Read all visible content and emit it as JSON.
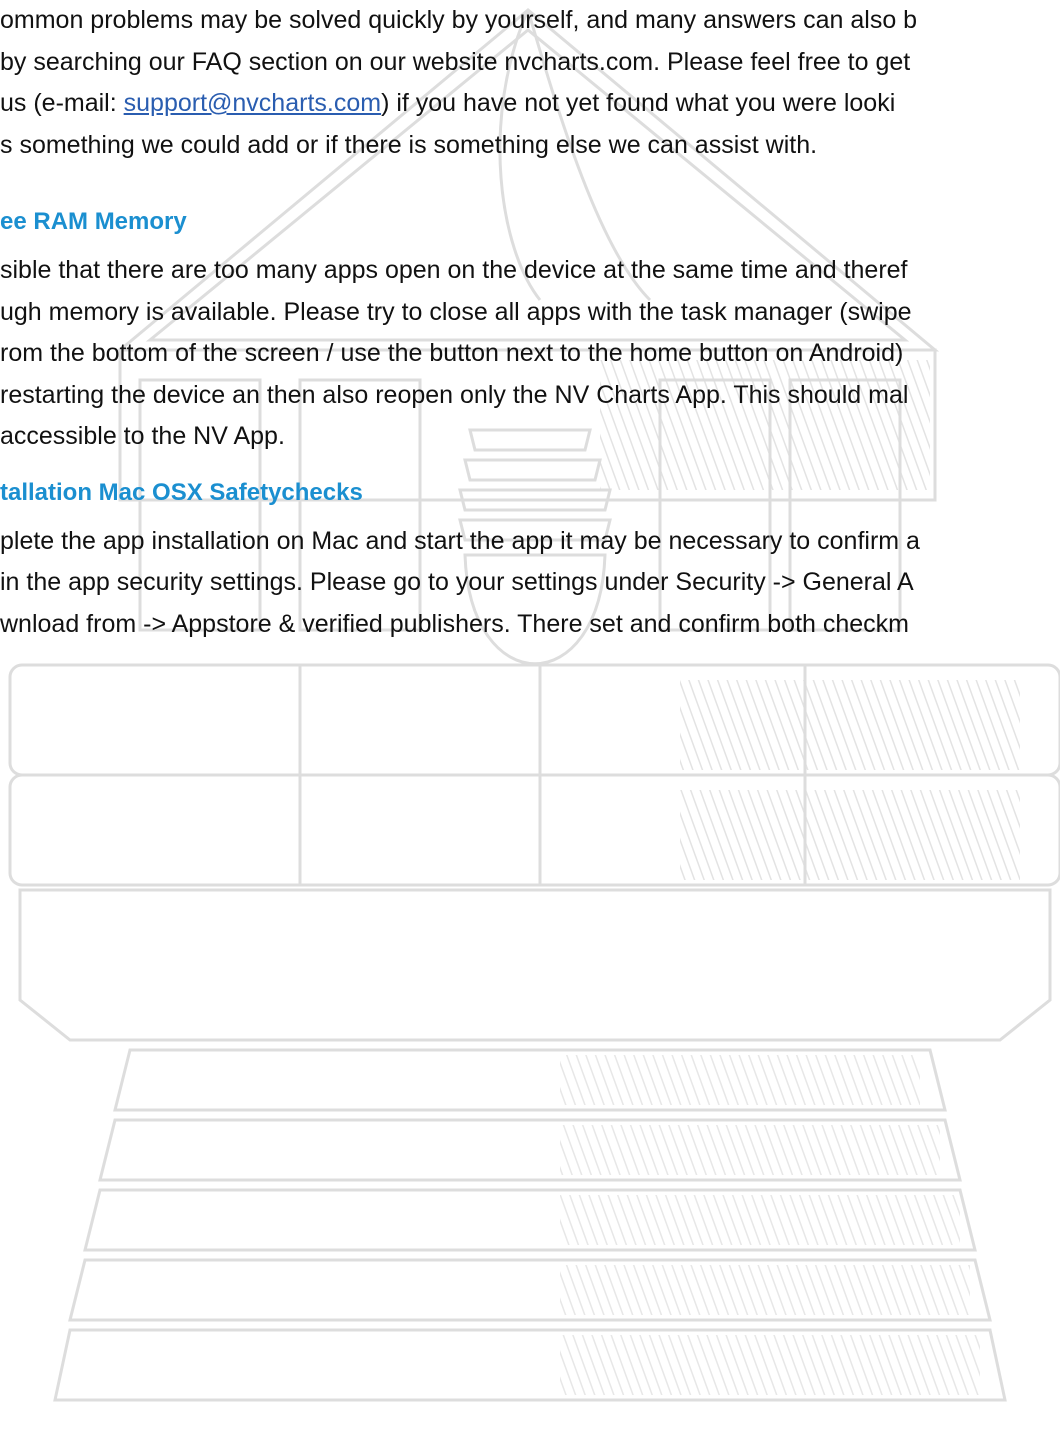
{
  "watermark": {
    "icon": "lighthouse-watermark-icon",
    "color": "#d9d9d9"
  },
  "section_faq": {
    "lines": [
      {
        "pre": "ommon problems may be solved quickly by yourself, and many answers can also b"
      },
      {
        "pre": "by searching our FAQ section on our website nvcharts.com. Please feel free to get"
      },
      {
        "pre": " us (e-mail: ",
        "link": "support@nvcharts.com",
        "post": ") if you have not yet found what you were looki"
      },
      {
        "pre": "s something we could add or if there is something else we can assist with."
      }
    ]
  },
  "section_ram": {
    "heading": "ee RAM Memory",
    "lines": [
      "sible that there are too many apps open on the device at the same time and theref",
      "ugh memory is available. Please try to close all apps with the task manager (swipe",
      "rom the bottom of the screen / use the button next to the home button on Android)",
      "restarting the device an then also reopen only the NV Charts App. This should mal",
      " accessible to the NV App."
    ]
  },
  "section_mac": {
    "heading": "tallation Mac OSX Safetychecks",
    "lines": [
      "plete the app installation on Mac and start the app it may be necessary to confirm a",
      "in the app security settings. Please go to your settings under Security -> General A",
      "wnload from -> Appstore & verified publishers. There set and confirm both checkm"
    ]
  },
  "colors": {
    "body_text": "#111111",
    "heading": "#1b8fd0",
    "link": "#2a5db0"
  }
}
